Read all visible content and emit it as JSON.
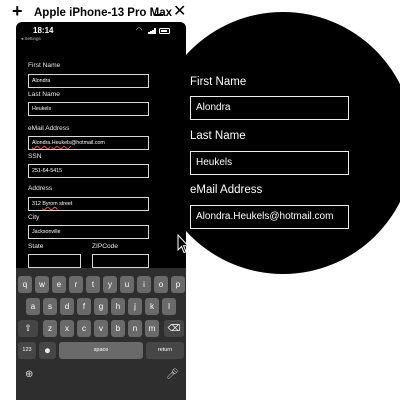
{
  "window": {
    "title": "Apple iPhone-13 Pro Max",
    "add_icon": "plus-icon",
    "minimize_icon": "minimize-icon",
    "close_icon": "close-icon"
  },
  "status_bar": {
    "time": "18:14",
    "back_label": "◂ Settings"
  },
  "form": {
    "first_name": {
      "label": "First Name",
      "value": "Alondra"
    },
    "last_name": {
      "label": "Last Name",
      "value": "Heukels"
    },
    "email": {
      "label": "eMail Address",
      "value_part1": "Alondra",
      "value_sep": ".",
      "value_part2": "Heukels",
      "value_part3": "@hotmail.com",
      "value": "Alondra.Heukels@hotmail.com"
    },
    "ssn": {
      "label": "SSN",
      "value": "251-64-5415"
    },
    "address": {
      "label": "Address",
      "value_part1": "312 ",
      "value_part2": "Byrom",
      "value_part3": " street"
    },
    "city": {
      "label": "City",
      "value": "Jacksonville"
    },
    "state": {
      "label": "State",
      "value": ""
    },
    "zip": {
      "label": "ZIPCode",
      "value": ""
    }
  },
  "keyboard": {
    "row1": [
      "q",
      "w",
      "e",
      "r",
      "t",
      "y",
      "u",
      "i",
      "o",
      "p"
    ],
    "row2": [
      "a",
      "s",
      "d",
      "f",
      "g",
      "h",
      "j",
      "k",
      "l"
    ],
    "row3": [
      "z",
      "x",
      "c",
      "v",
      "b",
      "n",
      "m"
    ],
    "numbers_key": "123",
    "emoji_key": "☻",
    "space_key": "space",
    "return_key": "return",
    "shift_icon": "shift-icon",
    "delete_icon": "delete-icon",
    "globe_icon": "globe-icon",
    "mic_icon": "microphone-icon"
  },
  "zoom": {
    "first_name_label": "First Name",
    "first_name_value": "Alondra",
    "last_name_label": "Last Name",
    "last_name_value": "Heukels",
    "email_label": "eMail Address",
    "email_value": "Alondra.Heukels@hotmail.com"
  }
}
